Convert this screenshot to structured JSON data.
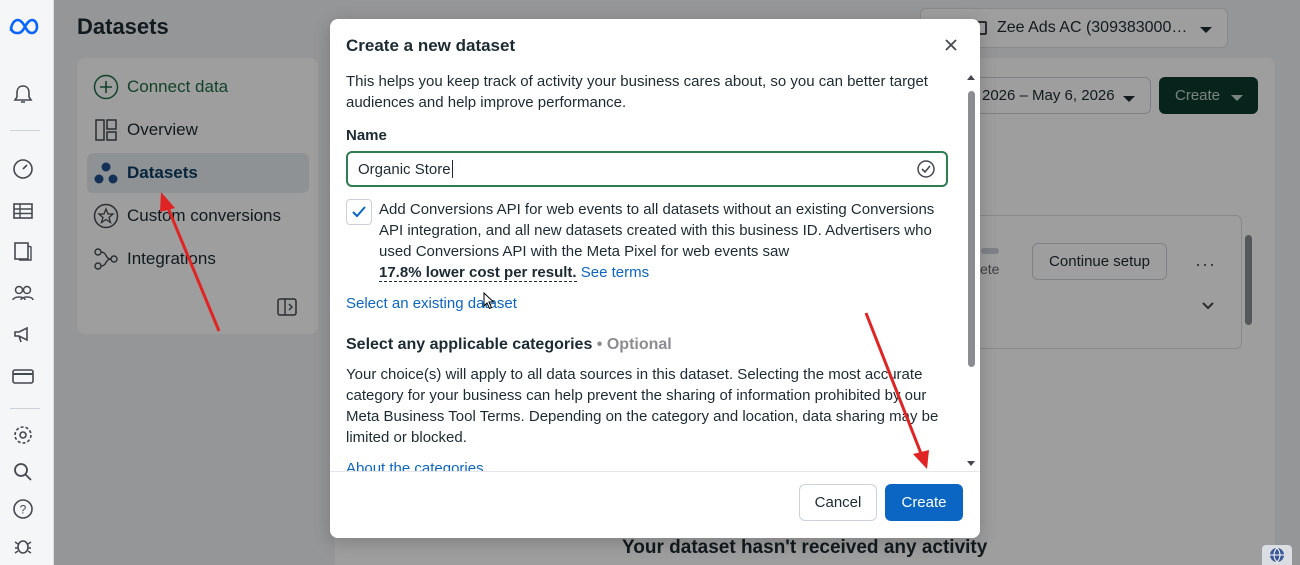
{
  "app": {
    "logo": "meta-logo",
    "page_title": "Datasets"
  },
  "rail": {
    "icons": [
      "bell-icon",
      "dashboard-icon",
      "table-icon",
      "catalog-icon",
      "people-icon",
      "megaphone-icon",
      "billing-icon",
      "settings-icon",
      "search-icon",
      "help-icon",
      "bug-icon"
    ]
  },
  "nav": {
    "connect": "Connect data",
    "items": [
      {
        "label": "Overview"
      },
      {
        "label": "Datasets"
      },
      {
        "label": "Custom conversions"
      },
      {
        "label": "Integrations"
      }
    ]
  },
  "header": {
    "account": "Zee Ads AC (309383000…",
    "date_range": "2026 – May 6, 2026",
    "create_label": "Create"
  },
  "background": {
    "continue_setup": "Continue setup",
    "partial_text": "ete",
    "empty_title": "Your dataset hasn't received any activity"
  },
  "modal": {
    "title": "Create a new dataset",
    "intro": "This helps you keep track of activity your business cares about, so you can better target audiences and help improve performance.",
    "name_label": "Name",
    "name_value": "Organic Store",
    "checkbox_checked": true,
    "checkbox_text": "Add Conversions API for web events to all datasets without an existing Conversions API integration, and all new datasets created with this business ID. Advertisers who used Conversions API with the Meta Pixel for web events saw",
    "checkbox_stat": "17.8% lower cost per result.",
    "see_terms": "See terms",
    "select_existing": "Select an existing dataset",
    "categories_title": "Select any applicable categories",
    "categories_optional": "• Optional",
    "categories_text": "Your choice(s) will apply to all data sources in this dataset. Selecting the most accurate category for your business can help prevent the sharing of information prohibited by our Meta Business Tool Terms. Depending on the category and location, data sharing may be limited or blocked.",
    "about_categories": "About the categories",
    "cancel_label": "Cancel",
    "create_label": "Create"
  },
  "colors": {
    "primary": "#0a66c2",
    "dark_green": "#0c3b2e",
    "valid_green": "#2e7d52",
    "arrow_red": "#e02424"
  }
}
